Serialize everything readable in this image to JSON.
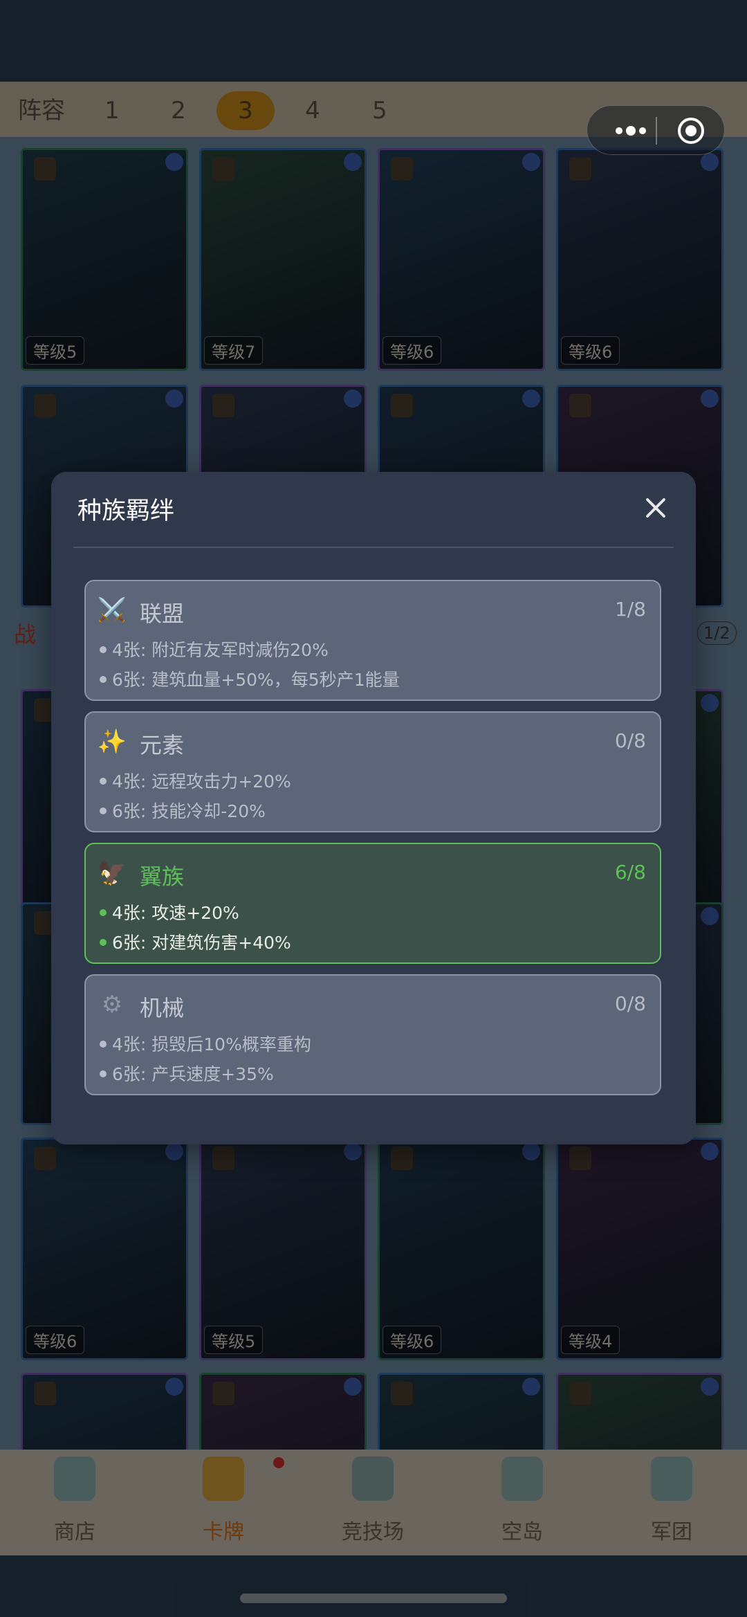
{
  "tabs": {
    "label": "阵容",
    "items": [
      "1",
      "2",
      "3",
      "4",
      "5"
    ],
    "active_index": 2
  },
  "side": {
    "left": "战",
    "right": "1/2"
  },
  "card_rows": [
    {
      "levels": [
        "等级5",
        "等级7",
        "等级6",
        "等级6"
      ]
    },
    {
      "levels": [
        "",
        "",
        "",
        ""
      ]
    },
    {
      "levels": [
        "",
        "",
        "",
        ""
      ]
    },
    {
      "levels": [
        "",
        "",
        "",
        ""
      ]
    },
    {
      "levels": [
        "等级6",
        "等级5",
        "等级6",
        "等级4"
      ]
    },
    {
      "levels": [
        "",
        "",
        "",
        ""
      ]
    }
  ],
  "nav": {
    "items": [
      {
        "label": "商店",
        "icon": "shop-icon"
      },
      {
        "label": "卡牌",
        "icon": "cards-icon"
      },
      {
        "label": "竞技场",
        "icon": "arena-icon"
      },
      {
        "label": "空岛",
        "icon": "sky-island-icon"
      },
      {
        "label": "军团",
        "icon": "legion-icon"
      }
    ],
    "active_index": 1
  },
  "modal": {
    "title": "种族羁绊",
    "bonds": [
      {
        "name": "联盟",
        "count": "1/8",
        "icon": "⚔️",
        "line1": "4张: 附近有友军时减伤20%",
        "line2": "6张: 建筑血量+50%，每5秒产1能量",
        "active": false
      },
      {
        "name": "元素",
        "count": "0/8",
        "icon": "✨",
        "line1": "4张: 远程攻击力+20%",
        "line2": "6张: 技能冷却-20%",
        "active": false
      },
      {
        "name": "翼族",
        "count": "6/8",
        "icon": "🦅",
        "line1": "4张: 攻速+20%",
        "line2": "6张: 对建筑伤害+40%",
        "active": true
      },
      {
        "name": "机械",
        "count": "0/8",
        "icon": "⚙",
        "line1": "4张: 损毁后10%概率重构",
        "line2": "6张: 产兵速度+35%",
        "active": false
      }
    ]
  },
  "colors": {
    "accent": "#c98a1c",
    "active_bond": "#5cc258",
    "modal_bg": "#30394c"
  }
}
